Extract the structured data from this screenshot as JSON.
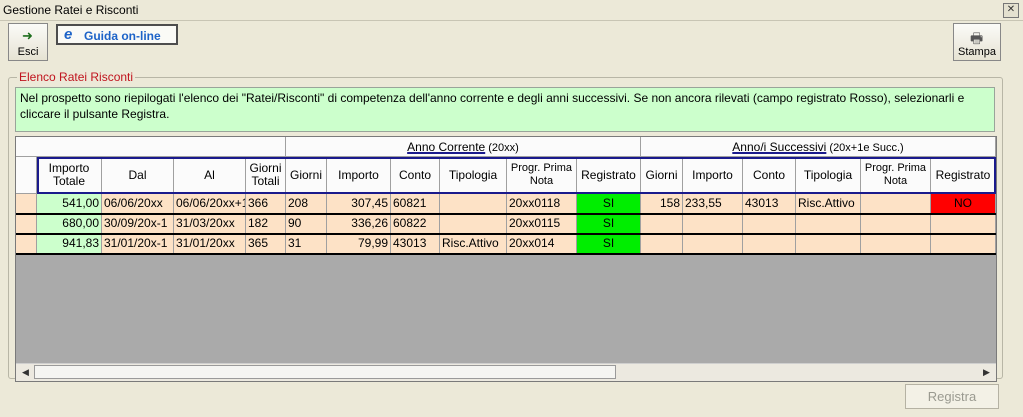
{
  "window": {
    "title": "Gestione Ratei e Risconti",
    "close_glyph": "✕"
  },
  "toolbar": {
    "esci_label": "Esci",
    "guida_icon": "e",
    "guida_label": "Guida on-line",
    "stampa_label": "Stampa"
  },
  "section_title": "Elenco Ratei Risconti",
  "info_text": "Nel prospetto sono riepilogati l'elenco dei \"Ratei/Risconti\" di competenza dell'anno corrente e degli anni successivi. Se non ancora rilevati (campo registrato Rosso), selezionarli e cliccare il pulsante Registra.",
  "groups": {
    "anno_corrente": {
      "label": "Anno Corrente",
      "suffix": " (20xx)"
    },
    "anni_successivi": {
      "label": "Anno/i Successivi",
      "suffix": " (20x+1e Succ.)"
    }
  },
  "columns": [
    "Importo Totale",
    "Dal",
    "Al",
    "Giorni Totali",
    "Giorni",
    "Importo",
    "Conto",
    "Tipologia",
    "Progr. Prima Nota",
    "Registrato",
    "Giorni",
    "Importo",
    "Conto",
    "Tipologia",
    "Progr. Prima Nota",
    "Registrato"
  ],
  "rows": [
    [
      "541,00",
      "06/06/20xx",
      "06/06/20xx+1",
      "366",
      "208",
      "307,45",
      "60821",
      "",
      "20xx0118",
      "SI",
      "158",
      "233,55",
      "43013",
      "Risc.Attivo",
      "",
      "NO"
    ],
    [
      "680,00",
      "30/09/20x-1",
      "31/03/20xx",
      "182",
      "90",
      "336,26",
      "60822",
      "",
      "20xx0115",
      "SI",
      "",
      "",
      "",
      "",
      "",
      ""
    ],
    [
      "941,83",
      "31/01/20x-1",
      "31/01/20xx",
      "365",
      "31",
      "79,99",
      "43013",
      "Risc.Attivo",
      "20xx014",
      "SI",
      "",
      "",
      "",
      "",
      "",
      ""
    ]
  ],
  "colors": {
    "row_bg": "#fde2c6",
    "importo_bg": "#ccffcc",
    "si_bg": "#00ee00",
    "no_bg": "#ff0000",
    "info_bg": "#ccffcc",
    "section_title": "#c0141e"
  },
  "scroll": {
    "left_glyph": "◀",
    "right_glyph": "▶"
  },
  "footer": {
    "registra_label": "Registra"
  }
}
